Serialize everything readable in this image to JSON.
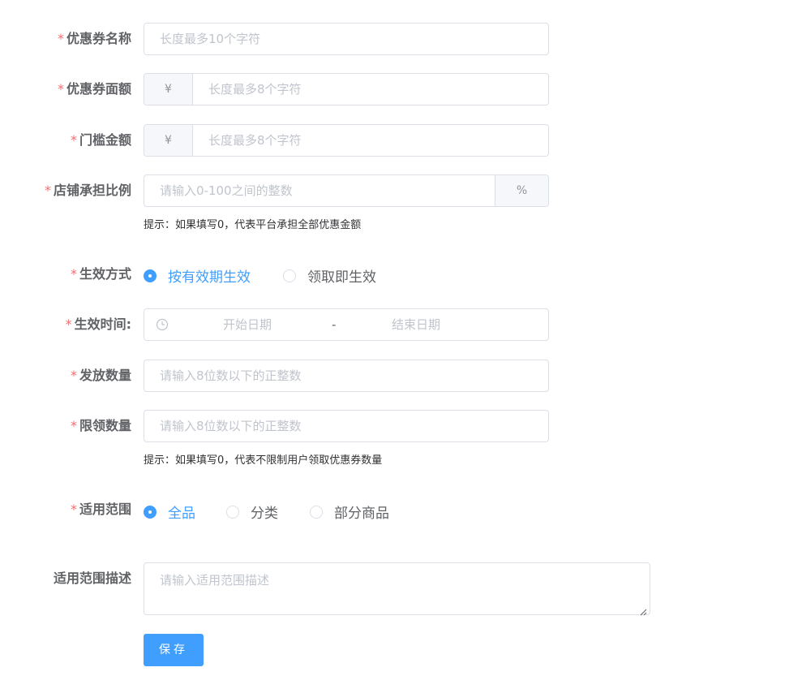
{
  "form": {
    "coupon_name": {
      "label": "优惠券名称",
      "placeholder": "长度最多10个字符"
    },
    "coupon_amount": {
      "label": "优惠券面额",
      "prefix": "¥",
      "placeholder": "长度最多8个字符"
    },
    "threshold_amount": {
      "label": "门槛金额",
      "prefix": "¥",
      "placeholder": "长度最多8个字符"
    },
    "store_ratio": {
      "label": "店铺承担比例",
      "placeholder": "请输入0-100之间的整数",
      "suffix": "%",
      "hint": "提示：如果填写0，代表平台承担全部优惠金额"
    },
    "effect_mode": {
      "label": "生效方式",
      "options": [
        {
          "label": "按有效期生效",
          "checked": true
        },
        {
          "label": "领取即生效",
          "checked": false
        }
      ]
    },
    "effect_time": {
      "label": "生效时间:",
      "start_placeholder": "开始日期",
      "separator": "-",
      "end_placeholder": "结束日期"
    },
    "issue_quantity": {
      "label": "发放数量",
      "placeholder": "请输入8位数以下的正整数"
    },
    "limit_quantity": {
      "label": "限领数量",
      "placeholder": "请输入8位数以下的正整数",
      "hint": "提示：如果填写0，代表不限制用户领取优惠券数量"
    },
    "scope": {
      "label": "适用范围",
      "options": [
        {
          "label": "全品",
          "checked": true
        },
        {
          "label": "分类",
          "checked": false
        },
        {
          "label": "部分商品",
          "checked": false
        }
      ]
    },
    "scope_desc": {
      "label": "适用范围描述",
      "placeholder": "请输入适用范围描述"
    },
    "required_mark": "*",
    "save_label": "保存"
  },
  "colors": {
    "primary": "#409eff",
    "required": "#f56c6c",
    "placeholder": "#c0c4cc",
    "border": "#dcdfe6"
  }
}
